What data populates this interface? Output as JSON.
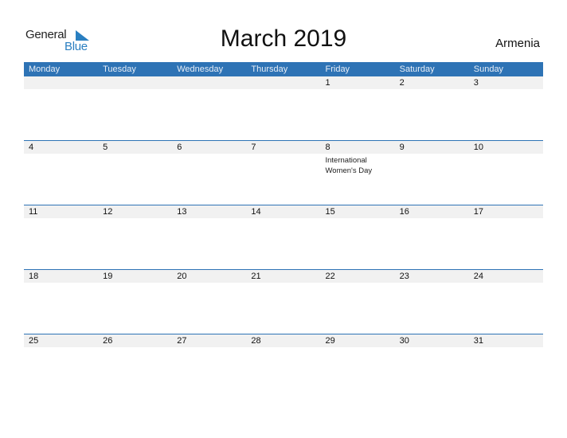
{
  "logo": {
    "word1": "General",
    "word2": "Blue",
    "accent": "#2a7fc1"
  },
  "title": "March 2019",
  "country": "Armenia",
  "colors": {
    "header_bg": "#2e73b5",
    "date_strip": "#f1f1f1"
  },
  "weekdays": [
    "Monday",
    "Tuesday",
    "Wednesday",
    "Thursday",
    "Friday",
    "Saturday",
    "Sunday"
  ],
  "weeks": [
    {
      "days": [
        {
          "num": "",
          "event": ""
        },
        {
          "num": "",
          "event": ""
        },
        {
          "num": "",
          "event": ""
        },
        {
          "num": "",
          "event": ""
        },
        {
          "num": "1",
          "event": ""
        },
        {
          "num": "2",
          "event": ""
        },
        {
          "num": "3",
          "event": ""
        }
      ]
    },
    {
      "days": [
        {
          "num": "4",
          "event": ""
        },
        {
          "num": "5",
          "event": ""
        },
        {
          "num": "6",
          "event": ""
        },
        {
          "num": "7",
          "event": ""
        },
        {
          "num": "8",
          "event": "International Women's Day"
        },
        {
          "num": "9",
          "event": ""
        },
        {
          "num": "10",
          "event": ""
        }
      ]
    },
    {
      "days": [
        {
          "num": "11",
          "event": ""
        },
        {
          "num": "12",
          "event": ""
        },
        {
          "num": "13",
          "event": ""
        },
        {
          "num": "14",
          "event": ""
        },
        {
          "num": "15",
          "event": ""
        },
        {
          "num": "16",
          "event": ""
        },
        {
          "num": "17",
          "event": ""
        }
      ]
    },
    {
      "days": [
        {
          "num": "18",
          "event": ""
        },
        {
          "num": "19",
          "event": ""
        },
        {
          "num": "20",
          "event": ""
        },
        {
          "num": "21",
          "event": ""
        },
        {
          "num": "22",
          "event": ""
        },
        {
          "num": "23",
          "event": ""
        },
        {
          "num": "24",
          "event": ""
        }
      ]
    },
    {
      "days": [
        {
          "num": "25",
          "event": ""
        },
        {
          "num": "26",
          "event": ""
        },
        {
          "num": "27",
          "event": ""
        },
        {
          "num": "28",
          "event": ""
        },
        {
          "num": "29",
          "event": ""
        },
        {
          "num": "30",
          "event": ""
        },
        {
          "num": "31",
          "event": ""
        }
      ]
    }
  ]
}
